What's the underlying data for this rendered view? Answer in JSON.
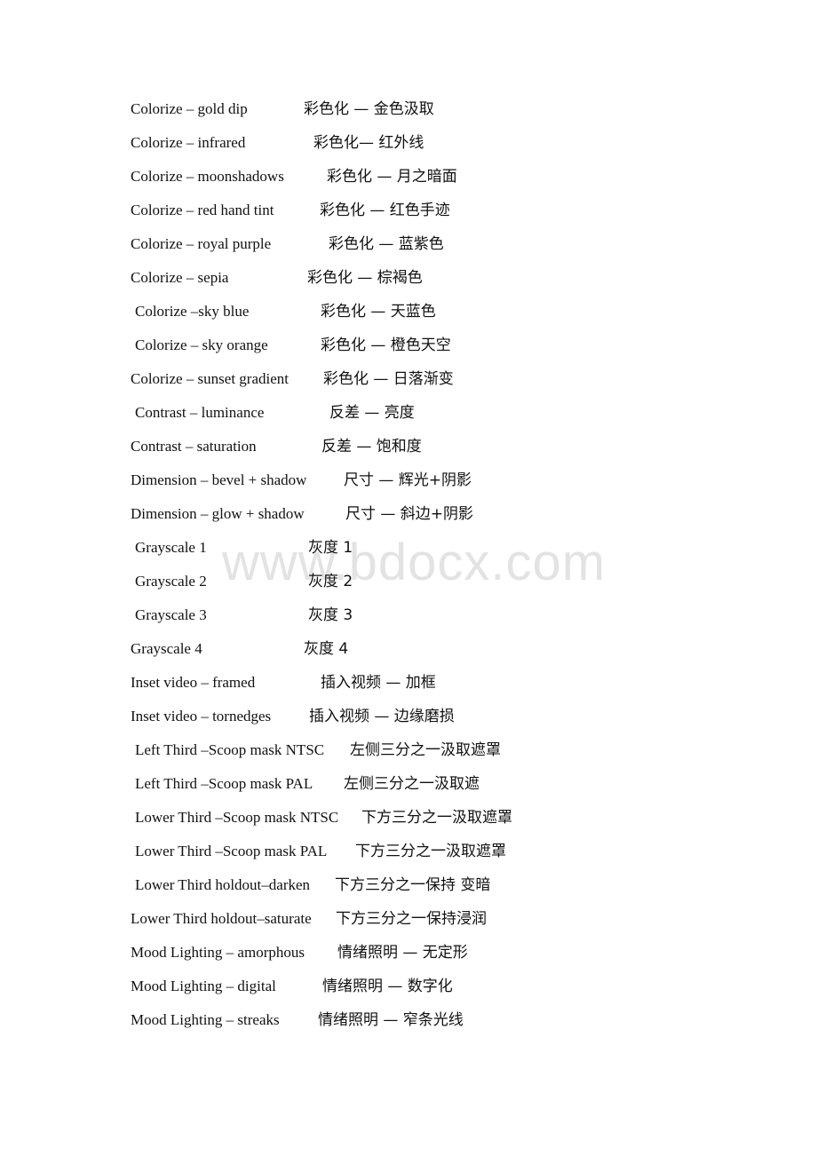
{
  "watermark": "www.bdocx.com",
  "rows": [
    {
      "en": "Colorize – gold dip",
      "zh": "彩色化 —  金色汲取"
    },
    {
      "en": "Colorize – infrared",
      "zh": "彩色化— 红外线"
    },
    {
      "en": "Colorize – moonshadows",
      "zh": "彩色化 — 月之暗面"
    },
    {
      "en": "Colorize – red hand tint",
      "zh": "彩色化 — 红色手迹"
    },
    {
      "en": "Colorize – royal purple",
      "zh": "彩色化 — 蓝紫色"
    },
    {
      "en": "Colorize – sepia",
      "zh": "彩色化 — 棕褐色"
    },
    {
      "en": "Colorize –sky blue",
      "zh": "彩色化 — 天蓝色"
    },
    {
      "en": "Colorize – sky orange",
      "zh": "彩色化 — 橙色天空"
    },
    {
      "en": "Colorize – sunset gradient",
      "zh": "彩色化  — 日落渐变"
    },
    {
      "en": "Contrast – luminance",
      "zh": "反差 — 亮度"
    },
    {
      "en": "Contrast – saturation",
      "zh": "反差 —  饱和度"
    },
    {
      "en": "Dimension – bevel + shadow",
      "zh": "尺寸 — 辉光+阴影"
    },
    {
      "en": "Dimension – glow + shadow",
      "zh": "尺寸 — 斜边+阴影"
    },
    {
      "en": "Grayscale 1",
      "zh": "灰度 1"
    },
    {
      "en": "Grayscale 2",
      "zh": "灰度 2"
    },
    {
      "en": "Grayscale 3",
      "zh": "灰度 3"
    },
    {
      "en": "Grayscale 4",
      "zh": "灰度 4"
    },
    {
      "en": "Inset video – framed",
      "zh": "插入视频 — 加框"
    },
    {
      "en": "Inset video – tornedges",
      "zh": "插入视频 — 边缘磨损"
    },
    {
      "en": "Left Third –Scoop mask NTSC",
      "zh": "左侧三分之一汲取遮罩"
    },
    {
      "en": "Left Third –Scoop mask PAL",
      "zh": "左侧三分之一汲取遮"
    },
    {
      "en": "Lower Third –Scoop mask NTSC",
      "zh": "下方三分之一汲取遮罩"
    },
    {
      "en": "Lower Third –Scoop mask PAL",
      "zh": "下方三分之一汲取遮罩"
    },
    {
      "en": "Lower Third  holdout–darken",
      "zh": "下方三分之一保持 变暗"
    },
    {
      "en": "Lower Third  holdout–saturate",
      "zh": "下方三分之一保持浸润"
    },
    {
      "en": "Mood Lighting – amorphous",
      "zh": "情绪照明 — 无定形"
    },
    {
      "en": "Mood Lighting – digital",
      "zh": "情绪照明 — 数字化"
    },
    {
      "en": "Mood Lighting – streaks",
      "zh": "情绪照明 — 窄条光线"
    }
  ]
}
